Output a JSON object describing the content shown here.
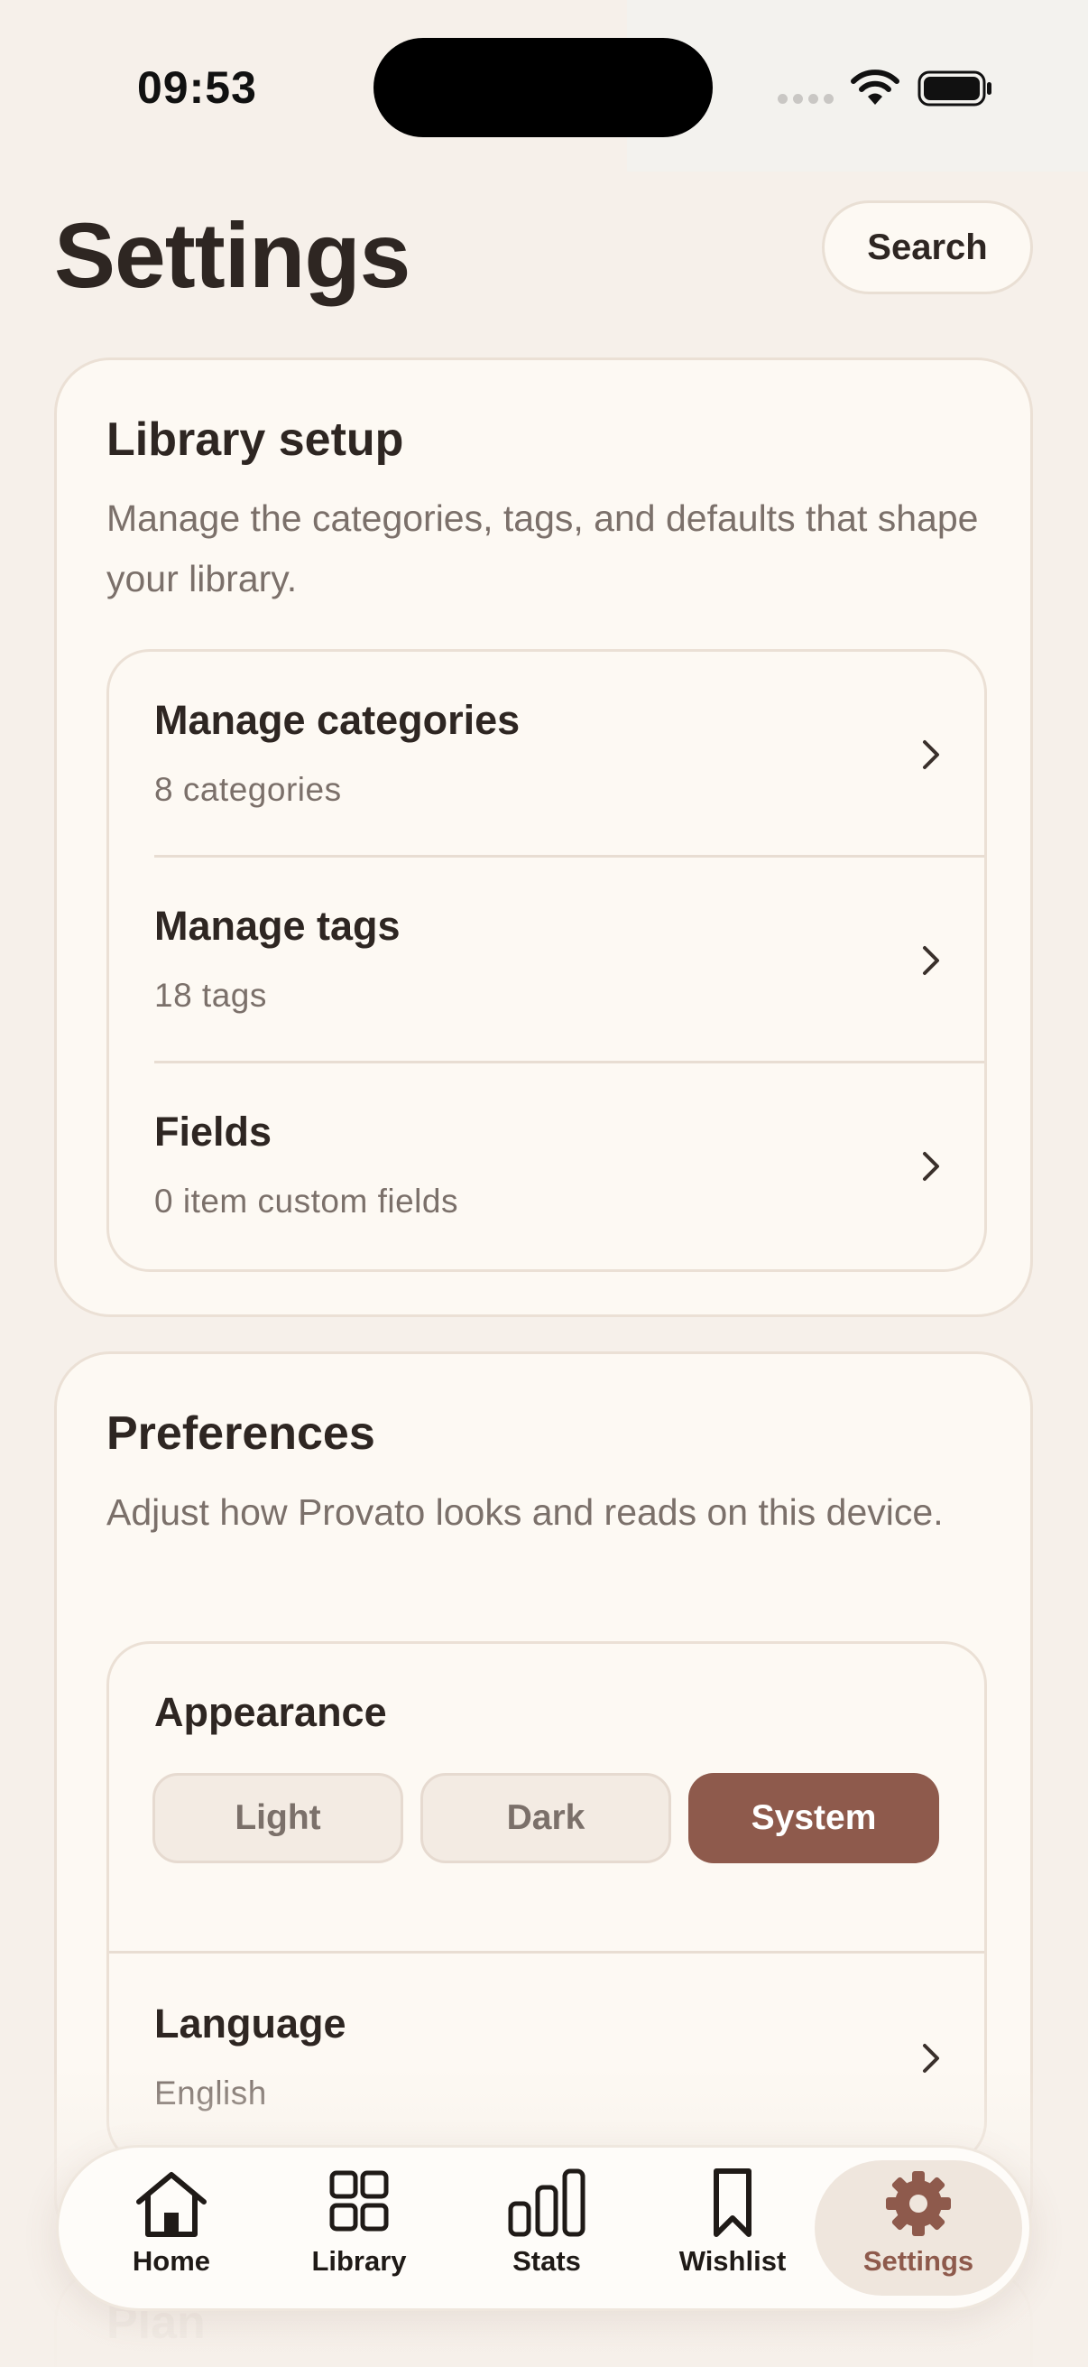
{
  "status_bar": {
    "time": "09:53"
  },
  "header": {
    "title": "Settings",
    "search_label": "Search"
  },
  "library_setup": {
    "title": "Library setup",
    "description": "Manage the categories, tags, and defaults that shape your library.",
    "rows": [
      {
        "title": "Manage categories",
        "subtitle": "8 categories"
      },
      {
        "title": "Manage tags",
        "subtitle": "18 tags"
      },
      {
        "title": "Fields",
        "subtitle": "0 item custom fields"
      }
    ]
  },
  "preferences": {
    "title": "Preferences",
    "description": "Adjust how Provato looks and reads on this device.",
    "appearance": {
      "label": "Appearance",
      "options": [
        "Light",
        "Dark",
        "System"
      ],
      "selected": "System"
    },
    "language": {
      "title": "Language",
      "value": "English"
    }
  },
  "plan": {
    "title": "Plan"
  },
  "tab_bar": {
    "items": [
      {
        "label": "Home",
        "icon": "home-icon"
      },
      {
        "label": "Library",
        "icon": "grid-icon"
      },
      {
        "label": "Stats",
        "icon": "bar-chart-icon"
      },
      {
        "label": "Wishlist",
        "icon": "bookmark-icon"
      },
      {
        "label": "Settings",
        "icon": "gear-icon"
      }
    ],
    "active": "Settings"
  },
  "colors": {
    "background": "#f6f0ea",
    "card": "#fdf9f3",
    "text": "#2e2622",
    "muted": "#7b706a",
    "accent": "#8e5a4c"
  }
}
